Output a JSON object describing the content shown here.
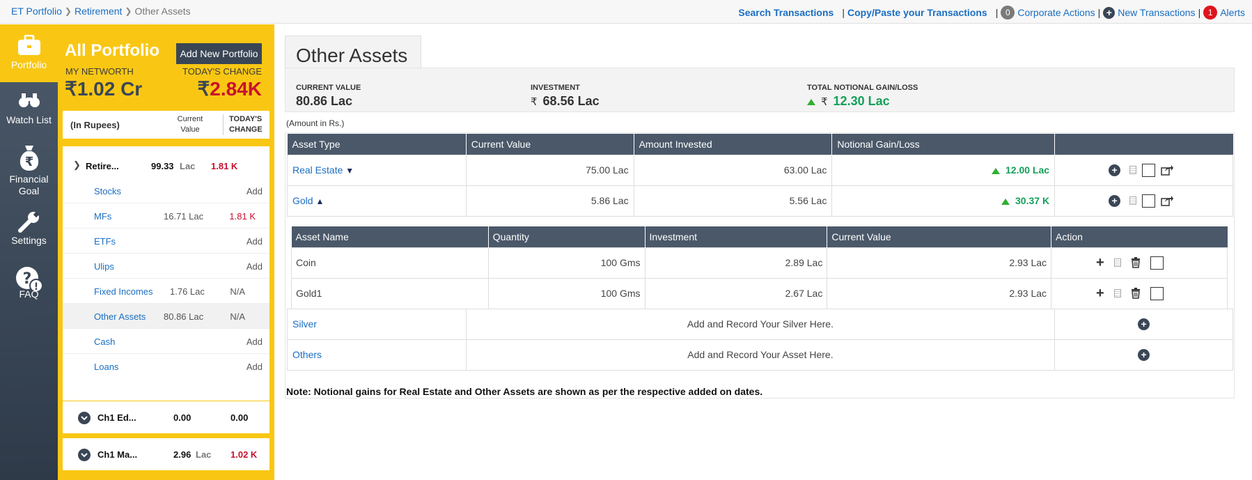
{
  "breadcrumb": {
    "items": [
      "ET Portfolio",
      "Retirement",
      "Other Assets"
    ]
  },
  "toplinks": {
    "search": "Search Transactions",
    "copy_paste": "Copy/Paste your Transactions",
    "corporate_count": "0",
    "corporate": "Corporate Actions",
    "new_txn": "New Transactions",
    "alerts_count": "1",
    "alerts": "Alerts"
  },
  "nav": [
    {
      "label": "Portfolio",
      "icon": "briefcase-icon",
      "active": true
    },
    {
      "label": "Watch List",
      "icon": "binoculars-icon"
    },
    {
      "label": "Financial Goal",
      "icon": "money-bag-icon"
    },
    {
      "label": "Settings",
      "icon": "wrench-icon"
    },
    {
      "label": "FAQ",
      "icon": "question-icon"
    }
  ],
  "portfolio": {
    "title": "All Portfolio",
    "add_button": "Add New Portfolio",
    "networth_label": "MY NETWORTH",
    "networth_value": "₹1.02 Cr",
    "change_label": "TODAY'S CHANGE",
    "change_symbol": "₹",
    "change_value": "2.84K",
    "header": {
      "c1": "(In Rupees)",
      "c2": "Current Value",
      "c3": "TODAY'S CHANGE"
    },
    "group": {
      "name": "Retire...",
      "value": "99.33",
      "unit": "Lac",
      "change": "1.81 K"
    },
    "rows": [
      {
        "name": "Stocks",
        "value": "",
        "change": "Add"
      },
      {
        "name": "MFs",
        "value": "16.71 Lac",
        "change": "1.81 K"
      },
      {
        "name": "ETFs",
        "value": "",
        "change": "Add"
      },
      {
        "name": "Ulips",
        "value": "",
        "change": "Add"
      },
      {
        "name": "Fixed Incomes",
        "value": "1.76 Lac",
        "change": "N/A"
      },
      {
        "name": "Other Assets",
        "value": "80.86 Lac",
        "change": "N/A"
      },
      {
        "name": "Cash",
        "value": "",
        "change": "Add"
      },
      {
        "name": "Loans",
        "value": "",
        "change": "Add"
      }
    ],
    "groups": [
      {
        "name": "Ch1 Ed...",
        "value": "0.00",
        "change": "0.00"
      },
      {
        "name": "Ch1 Ma...",
        "value": "2.96",
        "unit": "Lac",
        "change": "1.02 K"
      }
    ]
  },
  "main": {
    "tab": "Other Assets",
    "summary": {
      "cv_label": "CURRENT VALUE",
      "cv_value": "80.86 Lac",
      "inv_label": "INVESTMENT",
      "inv_symbol": "₹",
      "inv_value": "68.56 Lac",
      "gain_label": "TOTAL NOTIONAL GAIN/LOSS",
      "gain_symbol": "₹",
      "gain_value": "12.30 Lac"
    },
    "amount_note": "(Amount in Rs.)",
    "table_headers": [
      "Asset Type",
      "Current Value",
      "Amount Invested",
      "Notional Gain/Loss"
    ],
    "assets": [
      {
        "type": "Real Estate",
        "arrow": "▼",
        "cv": "75.00 Lac",
        "inv": "63.00 Lac",
        "gain": "12.00 Lac"
      },
      {
        "type": "Gold",
        "arrow": "▲",
        "cv": "5.86 Lac",
        "inv": "5.56 Lac",
        "gain": "30.37 K"
      }
    ],
    "sub_headers": [
      "Asset Name",
      "Quantity",
      "Investment",
      "Current Value",
      "Action"
    ],
    "sub_rows": [
      {
        "name": "Coin",
        "qty": "100 Gms",
        "inv": "2.89 Lac",
        "cv": "2.93 Lac"
      },
      {
        "name": "Gold1",
        "qty": "100 Gms",
        "inv": "2.67 Lac",
        "cv": "2.93 Lac"
      }
    ],
    "empty_rows": [
      {
        "type": "Silver",
        "text": "Add and Record Your Silver Here."
      },
      {
        "type": "Others",
        "text": "Add and Record Your Asset Here."
      }
    ],
    "note_label": "Note:",
    "note_text": "Notional gains for Real Estate and Other Assets are shown as per the respective added on dates."
  }
}
